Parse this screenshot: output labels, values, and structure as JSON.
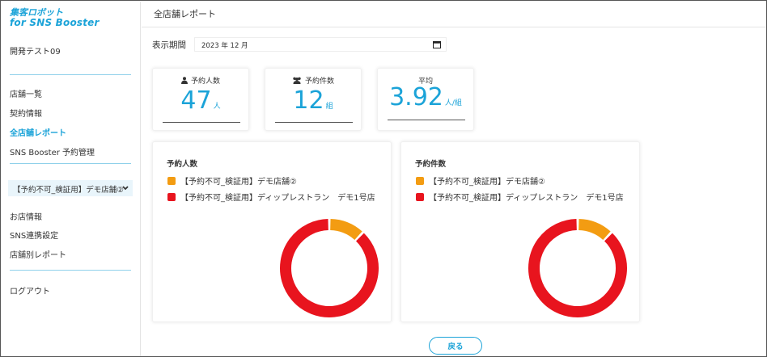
{
  "app": {
    "logo_line1": "集客ロボット",
    "logo_line2": "for SNS Booster",
    "account_name": "開発テスト09"
  },
  "sidebar": {
    "group1": [
      {
        "label": "店舗一覧",
        "active": false
      },
      {
        "label": "契約情報",
        "active": false
      },
      {
        "label": "全店舗レポート",
        "active": true
      },
      {
        "label": "SNS Booster 予約管理",
        "active": false
      }
    ],
    "store_select": {
      "value": "【予約不可_検証用】デモ店舗②"
    },
    "group2": [
      {
        "label": "お店情報"
      },
      {
        "label": "SNS連携設定"
      },
      {
        "label": "店舗別レポート"
      }
    ],
    "logout_label": "ログアウト"
  },
  "header": {
    "title": "全店舗レポート"
  },
  "period": {
    "label": "表示期間",
    "value": "2023 年 12 月"
  },
  "stats": [
    {
      "label": "予約人数",
      "icon": "person-icon",
      "value": "47",
      "unit": "人"
    },
    {
      "label": "予約件数",
      "icon": "group-icon",
      "value": "12",
      "unit": "組"
    },
    {
      "label": "平均",
      "icon": "",
      "value": "3.92",
      "unit": "人/組"
    }
  ],
  "colors": {
    "accent": "#1ba3d8",
    "series_orange": "#f39c12",
    "series_red": "#e8141e"
  },
  "chart_data": [
    {
      "type": "pie",
      "title": "予約人数",
      "categories": [
        "【予約不可_検証用】デモ店舗②",
        "【予約不可_検証用】ディップレストラン　デモ1号店"
      ],
      "values": [
        0.12,
        0.88
      ],
      "colors": [
        "#f39c12",
        "#e8141e"
      ],
      "legend": "top-left"
    },
    {
      "type": "pie",
      "title": "予約件数",
      "categories": [
        "【予約不可_検証用】デモ店舗②",
        "【予約不可_検証用】ディップレストラン　デモ1号店"
      ],
      "values": [
        0.12,
        0.88
      ],
      "colors": [
        "#f39c12",
        "#e8141e"
      ],
      "legend": "top-left"
    }
  ],
  "back_button": {
    "label": "戻る"
  }
}
